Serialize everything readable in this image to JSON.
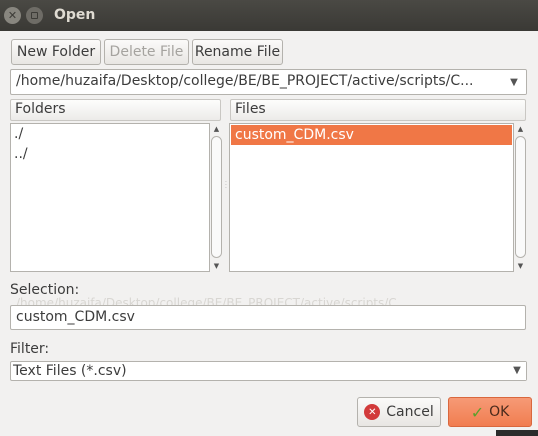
{
  "window": {
    "title": "Open"
  },
  "toolbar": {
    "new_folder_label": "New Folder",
    "delete_file_label": "Delete File",
    "rename_file_label": "Rename File"
  },
  "path_combo": {
    "value": "/home/huzaifa/Desktop/college/BE/BE_PROJECT/active/scripts/C..."
  },
  "folders": {
    "header": "Folders",
    "items": [
      "./",
      "../"
    ]
  },
  "files": {
    "header": "Files",
    "items": [
      "custom_CDM.csv"
    ],
    "selected_index": 0
  },
  "selection": {
    "label": "Selection:",
    "ghost_path": "/home/huzaifa/Desktop/college/BE/BE_PROJECT/active/scripts/C...",
    "value": "custom_CDM.csv"
  },
  "filter": {
    "label": "Filter:",
    "value": "Text Files (*.csv)"
  },
  "actions": {
    "cancel_label": "Cancel",
    "ok_label": "OK"
  },
  "colors": {
    "selection_accent": "#f07746",
    "titlebar": "#3c3b37",
    "dialog_bg": "#f2f1f0"
  },
  "icons": {
    "close": "close-icon",
    "minimize": "minimize-icon",
    "dropdown": "chevron-down-icon",
    "cancel": "cancel-icon",
    "ok": "checkmark-icon"
  }
}
